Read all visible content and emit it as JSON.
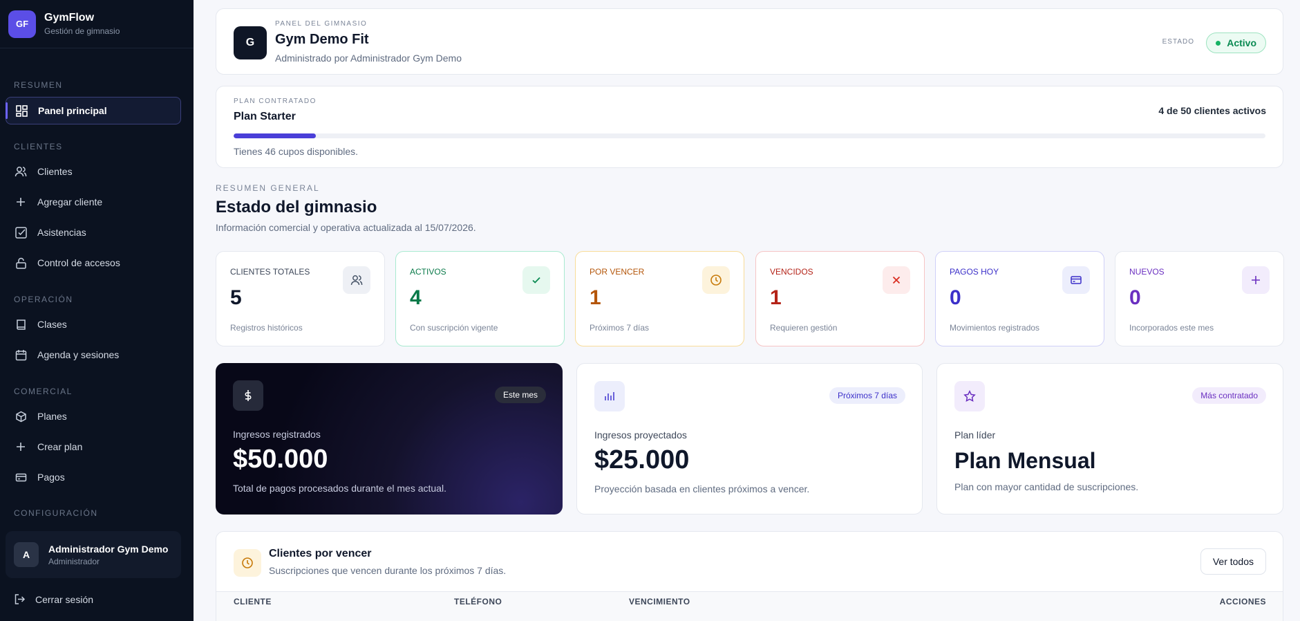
{
  "brand": {
    "logo": "GF",
    "name": "GymFlow",
    "subtitle": "Gestión de gimnasio"
  },
  "sidebar": {
    "sections": [
      "RESUMEN",
      "CLIENTES",
      "OPERACIÓN",
      "COMERCIAL",
      "CONFIGURACIÓN"
    ],
    "items": [
      {
        "label": "Panel principal",
        "icon": "dashboard-icon",
        "active": true
      },
      {
        "label": "Clientes",
        "icon": "users-icon"
      },
      {
        "label": "Agregar cliente",
        "icon": "plus-icon"
      },
      {
        "label": "Asistencias",
        "icon": "check-square-icon"
      },
      {
        "label": "Control de accesos",
        "icon": "lock-icon"
      },
      {
        "label": "Clases",
        "icon": "book-icon"
      },
      {
        "label": "Agenda y sesiones",
        "icon": "calendar-icon"
      },
      {
        "label": "Planes",
        "icon": "box-icon"
      },
      {
        "label": "Crear plan",
        "icon": "plus-icon"
      },
      {
        "label": "Pagos",
        "icon": "card-icon"
      }
    ],
    "user": {
      "initial": "A",
      "name": "Administrador Gym Demo",
      "role": "Administrador"
    },
    "logout": "Cerrar sesión"
  },
  "gym": {
    "eyebrow": "PANEL DEL GIMNASIO",
    "initial": "G",
    "name": "Gym Demo Fit",
    "admin": "Administrado por Administrador Gym Demo",
    "status_label": "ESTADO",
    "status": "Activo"
  },
  "plan": {
    "eyebrow": "PLAN CONTRATADO",
    "name": "Plan Starter",
    "usage": "4 de 50 clientes activos",
    "progress_fraction": 0.08,
    "available": "Tienes 46 cupos disponibles."
  },
  "overview": {
    "eyebrow": "RESUMEN GENERAL",
    "title": "Estado del gimnasio",
    "subtitle": "Información comercial y operativa actualizada al 15/07/2026."
  },
  "stats": [
    {
      "label": "CLIENTES TOTALES",
      "value": "5",
      "sub": "Registros históricos",
      "icon": "users-icon",
      "color": "#0f172a",
      "border": "#e5e8ef",
      "icon_bg": "#eef0f5"
    },
    {
      "label": "ACTIVOS",
      "value": "4",
      "sub": "Con suscripción vigente",
      "icon": "check-icon",
      "color": "#0a7a4a",
      "border": "#a8ead0",
      "icon_bg": "#e6f8ef"
    },
    {
      "label": "POR VENCER",
      "value": "1",
      "sub": "Próximos 7 días",
      "icon": "clock-icon",
      "color": "#b4560a",
      "border": "#f8dc98",
      "icon_bg": "#fdf3dc"
    },
    {
      "label": "VENCIDOS",
      "value": "1",
      "sub": "Requieren gestión",
      "icon": "x-icon",
      "color": "#b42318",
      "border": "#f6c4c4",
      "icon_bg": "#fdecec"
    },
    {
      "label": "PAGOS HOY",
      "value": "0",
      "sub": "Movimientos registrados",
      "icon": "card-icon",
      "color": "#3b2fc9",
      "border": "#cfd0f8",
      "icon_bg": "#eceefc"
    },
    {
      "label": "NUEVOS",
      "value": "0",
      "sub": "Incorporados este mes",
      "icon": "plus-icon",
      "color": "#6a2fc0",
      "border": "#e5e8ef",
      "icon_bg": "#f2ecfc"
    }
  ],
  "income": {
    "tag": "Este mes",
    "label": "Ingresos registrados",
    "value": "$50.000",
    "sub": "Total de pagos procesados durante el mes actual.",
    "icon": "dollar-icon"
  },
  "projected": {
    "tag": "Próximos 7 días",
    "label": "Ingresos proyectados",
    "value": "$25.000",
    "sub": "Proyección basada en clientes próximos a vencer.",
    "icon": "bar-chart-icon"
  },
  "leader": {
    "tag": "Más contratado",
    "label": "Plan líder",
    "value": "Plan Mensual",
    "sub": "Plan con mayor cantidad de suscripciones.",
    "icon": "star-icon"
  },
  "expiring": {
    "title": "Clientes por vencer",
    "subtitle": "Suscripciones que vencen durante los próximos 7 días.",
    "button": "Ver todos",
    "columns": [
      "CLIENTE",
      "TELÉFONO",
      "VENCIMIENTO",
      "ACCIONES"
    ]
  }
}
